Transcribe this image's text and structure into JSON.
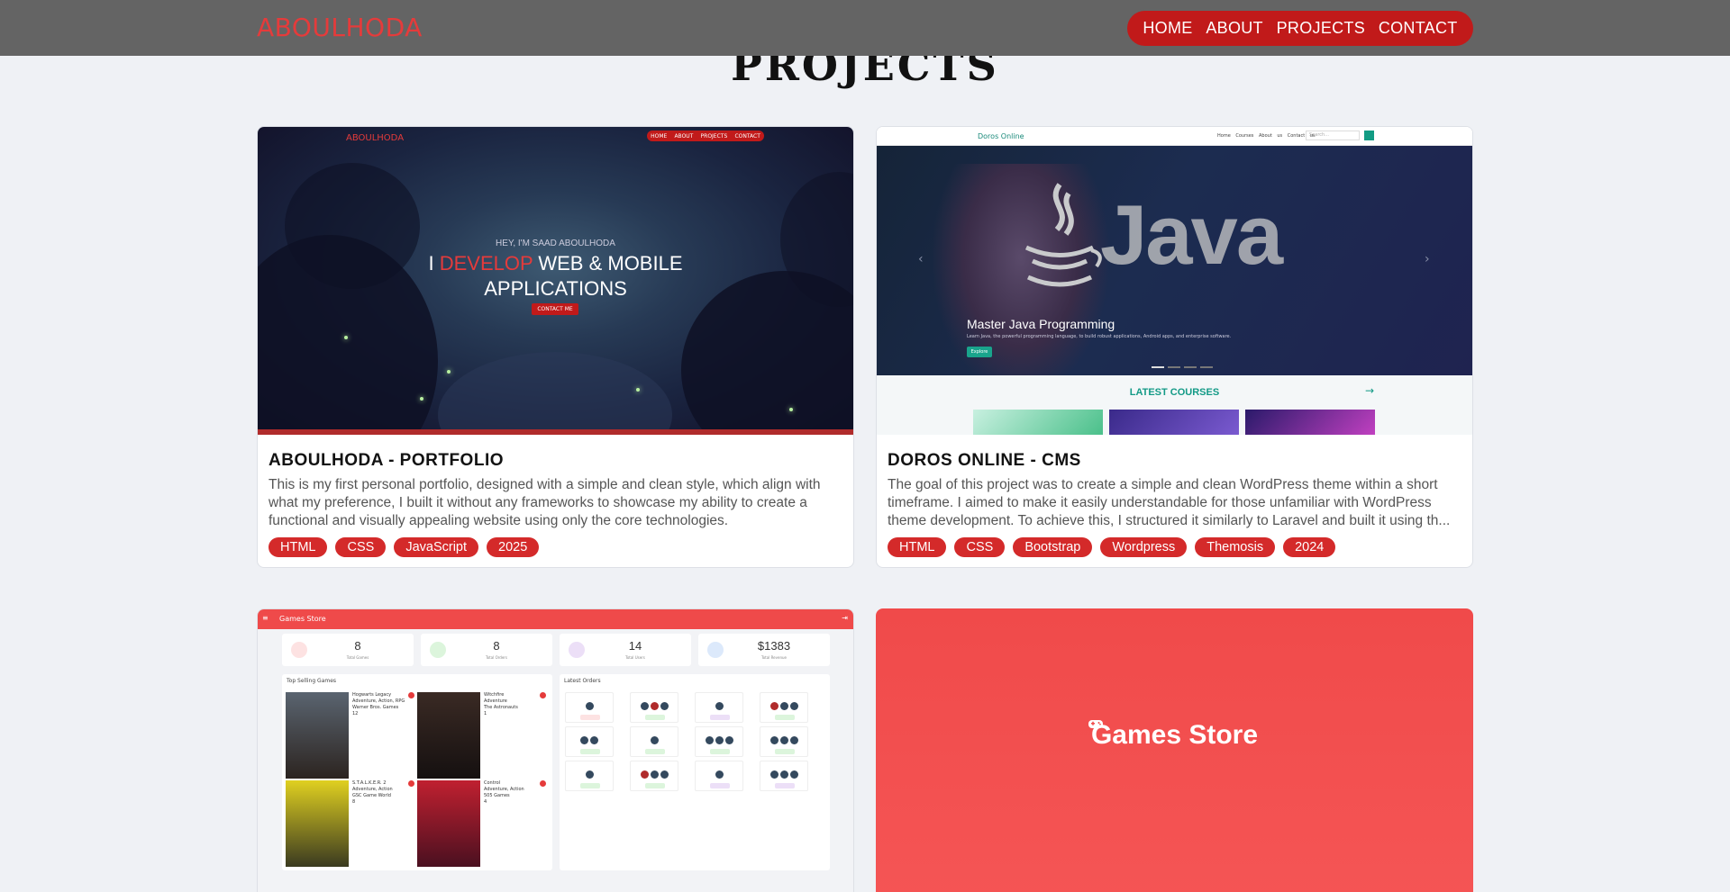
{
  "nav": {
    "logo": "ABOULHODA",
    "links": [
      "HOME",
      "ABOUT",
      "PROJECTS",
      "CONTACT"
    ]
  },
  "section": {
    "title": "PROJECTS"
  },
  "projects": [
    {
      "title": "ABOULHODA - PORTFOLIO",
      "description": "This is my first personal portfolio, designed with a simple and clean style, which align with what my preference, I built it without any frameworks to showcase my ability to create a functional and visually appealing website using only the core technologies.",
      "tags": [
        "HTML",
        "CSS",
        "JavaScript",
        "2025"
      ],
      "preview": {
        "logo": "ABOULHODA",
        "nav": [
          "HOME",
          "ABOUT",
          "PROJECTS",
          "CONTACT"
        ],
        "greeting": "HEY, I'M SAAD ABOULHODA",
        "headline_pre": "I ",
        "headline_highlight": "DEVELOP",
        "headline_post": " WEB & MOBILE",
        "headline_line2": "APPLICATIONS",
        "cta": "CONTACT ME"
      }
    },
    {
      "title": "DOROS ONLINE - CMS",
      "description": "The goal of this project was to create a simple and clean WordPress theme within a short timeframe. I aimed to make it easily understandable for those unfamiliar with WordPress theme development. To achieve this, I structured it similarly to Laravel and built it using th...",
      "tags": [
        "HTML",
        "CSS",
        "Bootstrap",
        "Wordpress",
        "Themosis",
        "2024"
      ],
      "preview": {
        "brand": "Doros Online",
        "links": "Home Courses About us Contact us",
        "search": "Search...",
        "hero_word": "Java",
        "caption": "Master Java Programming",
        "subcaption": "Learn Java, the powerful programming language, to build robust applications, Android apps, and enterprise software.",
        "explore": "Explore",
        "latest": "LATEST COURSES"
      }
    },
    {
      "preview": {
        "app_title": "Games Store",
        "stats": [
          {
            "value": "8",
            "label": "Total Games",
            "color": "#fde2e2"
          },
          {
            "value": "8",
            "label": "Total Orders",
            "color": "#dcf5dc"
          },
          {
            "value": "14",
            "label": "Total Users",
            "color": "#ecdff7"
          },
          {
            "value": "$1383",
            "label": "Total Revenue",
            "color": "#dce9fb"
          }
        ],
        "top_selling": "Top Selling Games",
        "latest_orders": "Latest Orders",
        "games": [
          {
            "name": "Hogwarts Legacy",
            "genre": "Adventure, Action, RPG",
            "publisher": "Warner Bros. Games",
            "sales": "12"
          },
          {
            "name": "Witchfire",
            "genre": "Adventure",
            "publisher": "The Astronauts",
            "sales": "1"
          },
          {
            "name": "S.T.A.L.K.E.R. 2",
            "genre": "Adventure, Action",
            "publisher": "GSC Game World",
            "sales": "8"
          },
          {
            "name": "Control",
            "genre": "Adventure, Action",
            "publisher": "505 Games",
            "sales": "4"
          }
        ]
      }
    },
    {
      "preview": {
        "title": "Games Store"
      }
    }
  ],
  "colors": {
    "accent": "#c11a1a",
    "tag": "#d42a2a",
    "navbar": "#646464",
    "background": "#eff1f5"
  }
}
